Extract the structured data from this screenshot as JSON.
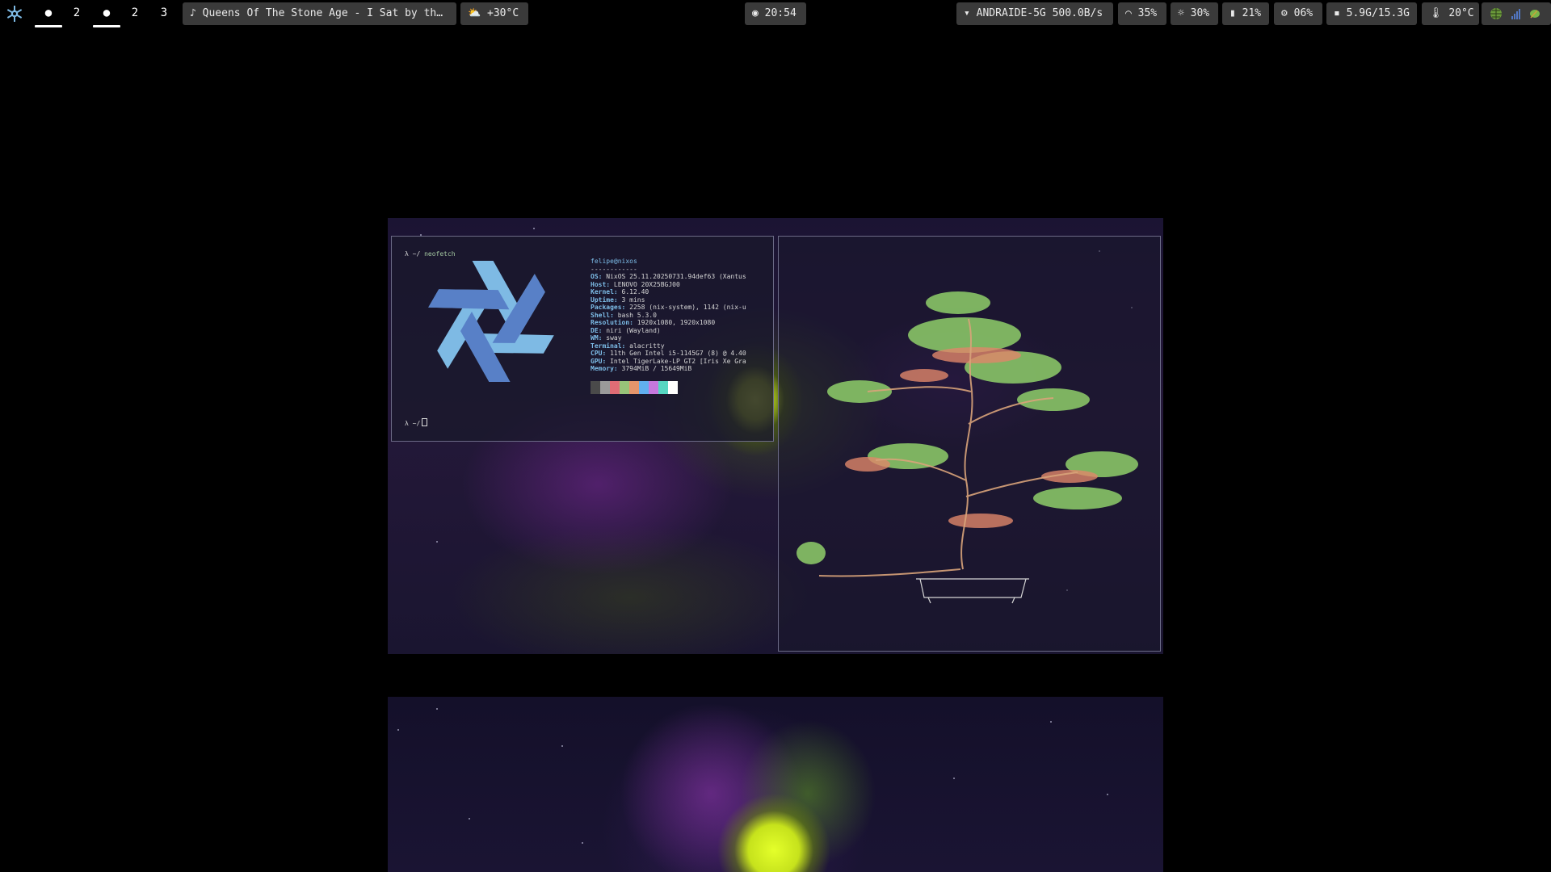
{
  "bar": {
    "workspaces": [
      {
        "label": "●",
        "active": true
      },
      {
        "label": "2",
        "active": false
      },
      {
        "label": "●",
        "active": true
      },
      {
        "label": "2",
        "active": false
      },
      {
        "label": "3",
        "active": false
      }
    ],
    "media": {
      "icon": "music-note-icon",
      "text": "♪ Queens Of The Stone Age - I Sat by th…"
    },
    "weather": {
      "icon": "partly-cloudy-icon",
      "text": "⛅ +30°C"
    },
    "clock": {
      "icon": "clock-icon",
      "text": "◉ 20:54"
    },
    "network": {
      "icon": "wifi-icon",
      "text": "▾ ANDRAIDE-5G 500.0B/s"
    },
    "volume": {
      "icon": "headphones-icon",
      "text": "⌒ 35%"
    },
    "brightness": {
      "icon": "brightness-icon",
      "text": "☼ 30%"
    },
    "battery": {
      "icon": "battery-icon",
      "text": "▮ 21%"
    },
    "cpu": {
      "icon": "cpu-icon",
      "text": "⚙ 06%"
    },
    "memory": {
      "icon": "memory-icon",
      "text": "▪ 5.9G/15.3G"
    },
    "temperature": {
      "icon": "thermometer-icon",
      "text": "🌡 20°C"
    },
    "tray": [
      "tray-globe-icon",
      "tray-signal-icon",
      "tray-leaf-icon"
    ]
  },
  "colors": {
    "bar_pill": "#3a3a3a",
    "nix_light": "#7ebae4",
    "nix_dark": "#5277c3",
    "info_key": "#7dbde8"
  },
  "terminal_left": {
    "prompt1": "λ ~/",
    "command": "neofetch",
    "prompt2": "λ ~/",
    "user_host": "felipe@nixos",
    "separator": "------------",
    "info": [
      {
        "key": "OS:",
        "value": " NixOS 25.11.20250731.94def63 (Xantus"
      },
      {
        "key": "Host:",
        "value": " LENOVO 20X25BGJ00"
      },
      {
        "key": "Kernel:",
        "value": " 6.12.40"
      },
      {
        "key": "Uptime:",
        "value": " 3 mins"
      },
      {
        "key": "Packages:",
        "value": " 2258 (nix-system), 1142 (nix-u"
      },
      {
        "key": "Shell:",
        "value": " bash 5.3.0"
      },
      {
        "key": "Resolution:",
        "value": " 1920x1080, 1920x1080"
      },
      {
        "key": "DE:",
        "value": " niri (Wayland)"
      },
      {
        "key": "WM:",
        "value": " sway"
      },
      {
        "key": "Terminal:",
        "value": " alacritty"
      },
      {
        "key": "CPU:",
        "value": " 11th Gen Intel i5-1145G7 (8) @ 4.40"
      },
      {
        "key": "GPU:",
        "value": " Intel TigerLake-LP GT2 [Iris Xe Gra"
      },
      {
        "key": "Memory:",
        "value": " 3794MiB / 15649MiB"
      }
    ],
    "swatch_colors": [
      "#4a4a4a",
      "#9a9a9a",
      "#e06c75",
      "#98c379",
      "#e5956b",
      "#61afef",
      "#c678dd",
      "#56d6c2",
      "#ffffff"
    ]
  },
  "terminal_right": {
    "content": "bonsai ascii art"
  }
}
